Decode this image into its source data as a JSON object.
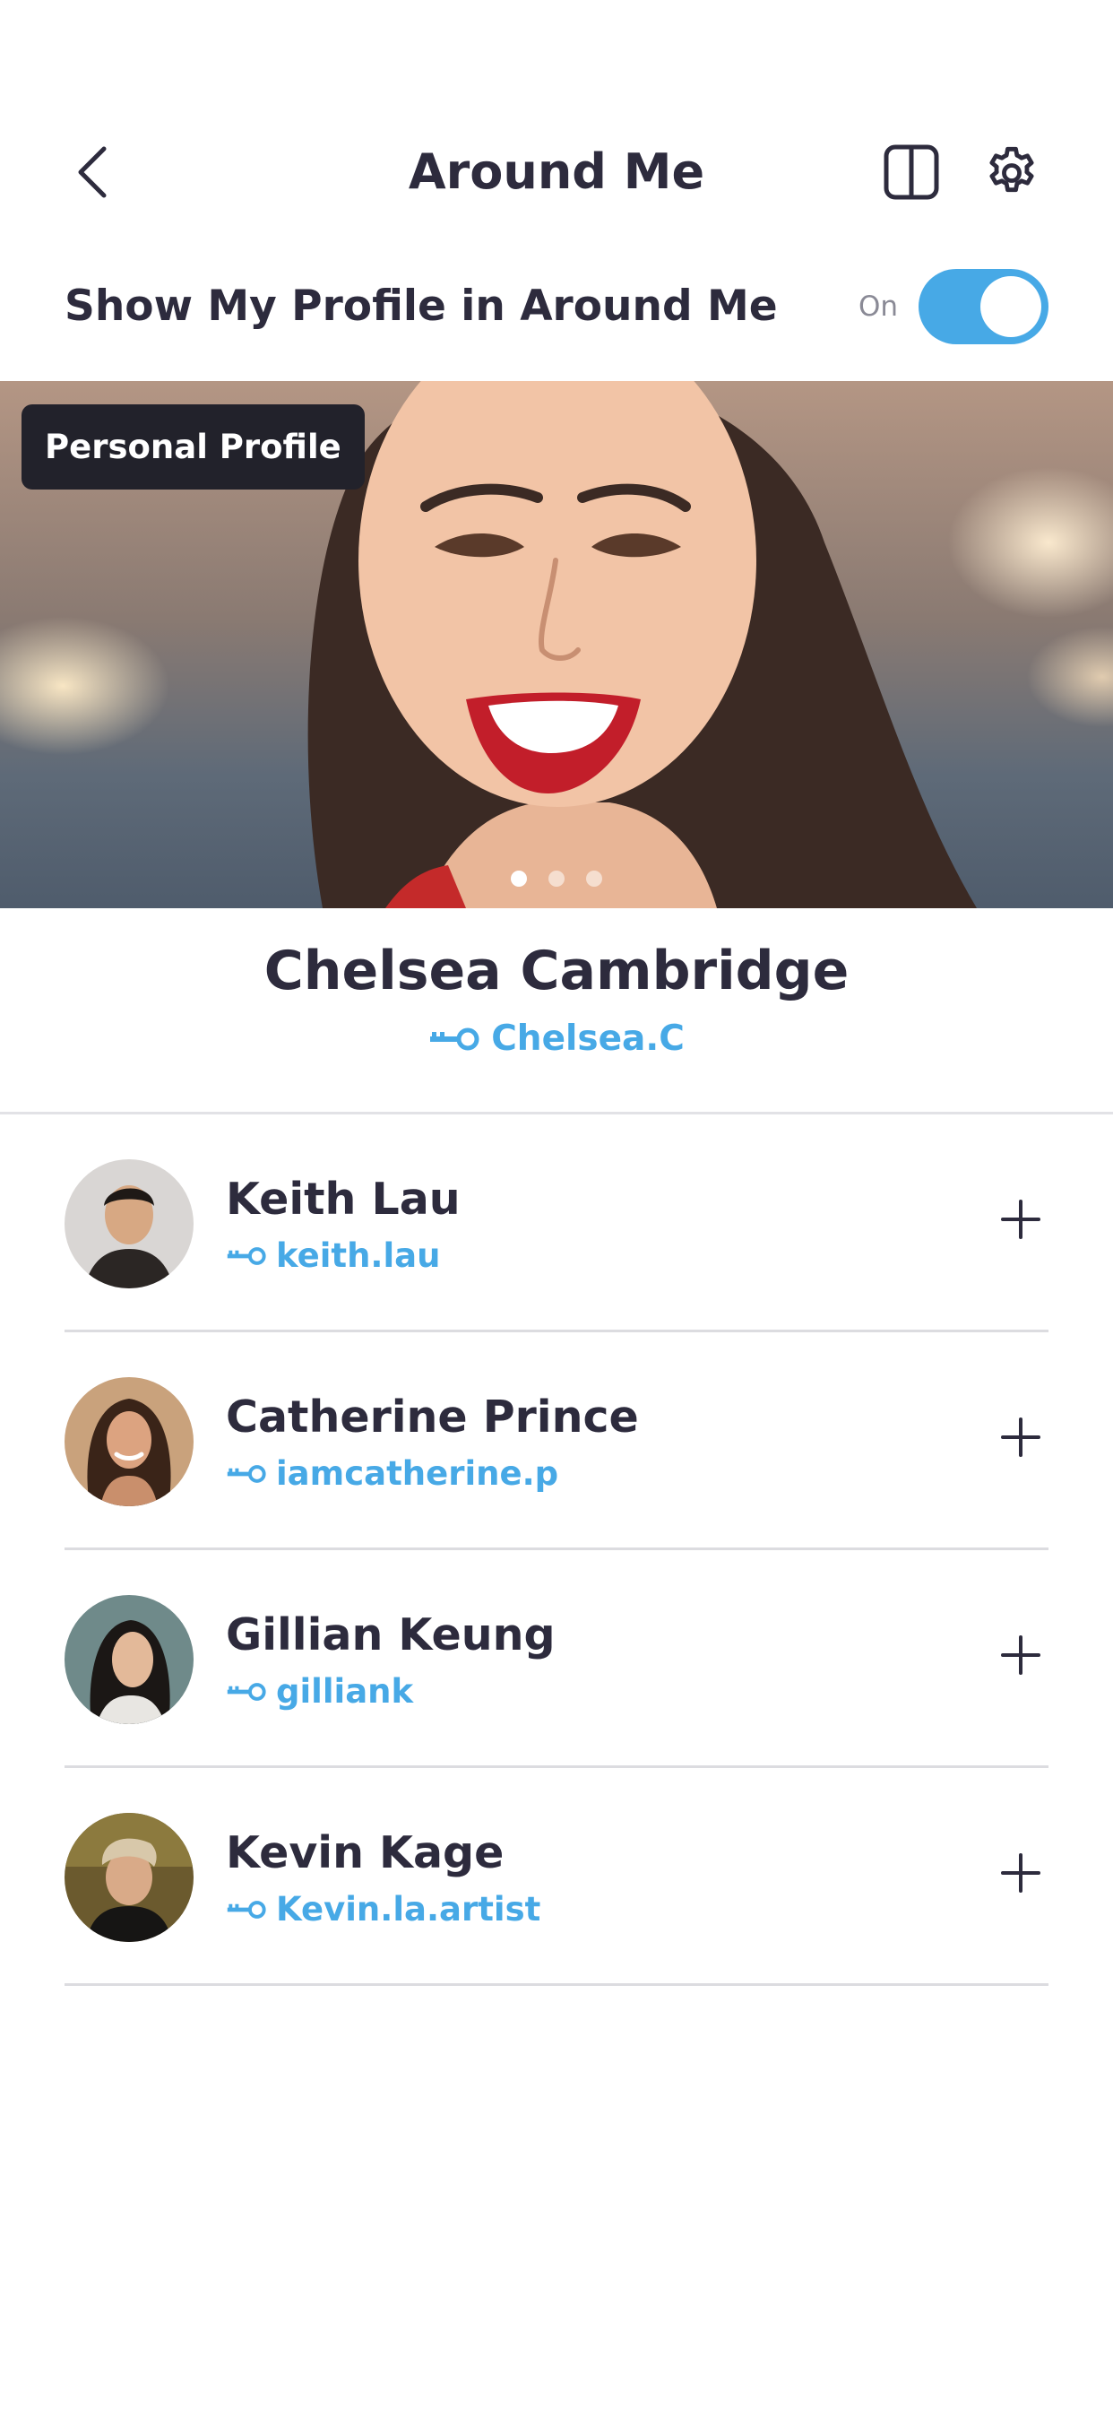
{
  "header": {
    "title": "Around Me",
    "back_icon": "chevron-left-icon",
    "layout_icon": "split-view-icon",
    "settings_icon": "gear-icon"
  },
  "visibility": {
    "label": "Show My Profile in Around Me",
    "state_label": "On",
    "enabled": true
  },
  "hero": {
    "badge": "Personal Profile",
    "photo_count": 3,
    "active_photo": 1
  },
  "profile": {
    "name": "Chelsea Cambridge",
    "handle": "Chelsea.C"
  },
  "people": [
    {
      "name": "Keith Lau",
      "handle": "keith.lau"
    },
    {
      "name": "Catherine Prince",
      "handle": "iamcatherine.p"
    },
    {
      "name": "Gillian Keung",
      "handle": "gilliank"
    },
    {
      "name": "Kevin Kage",
      "handle": "Kevin.la.artist"
    }
  ],
  "colors": {
    "accent": "#47a9e6",
    "text": "#2d2b3d",
    "badge_bg": "#22222b"
  }
}
